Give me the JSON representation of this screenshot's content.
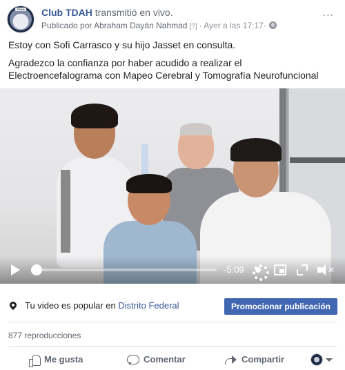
{
  "post": {
    "author": "Club TDAH",
    "action": "transmitió en vivo.",
    "published_by": "Publicado por Abraham Dayán Nahmad",
    "help_marker": "[?]",
    "separator": "·",
    "timestamp": "Ayer a las 17:17",
    "privacy_icon": "globe-icon",
    "avatar_label": "TDAH",
    "menu_label": "...",
    "text_paragraphs": [
      "Estoy con Sofi Carrasco y su hijo Jasset en consulta.",
      "Agradezco la confianza por haber acudido a realizar el Electroencefalograma con Mapeo Cerebral y Tomografía Neurofuncional"
    ]
  },
  "video": {
    "time_remaining": "-5:09",
    "progress": 0.02,
    "icons": [
      "play-icon",
      "settings-gear-icon",
      "picture-in-picture-icon",
      "fullscreen-icon",
      "mute-icon"
    ]
  },
  "promotion": {
    "text_before": "Tu video es popular en",
    "location": "Distrito Federal",
    "button_label": "Promocionar publicación"
  },
  "stats": {
    "views": "877 reproducciones"
  },
  "actions": {
    "like": "Me gusta",
    "comment": "Comentar",
    "share": "Compartir"
  },
  "colors": {
    "link": "#385898",
    "button": "#4267b2",
    "muted": "#616770"
  }
}
